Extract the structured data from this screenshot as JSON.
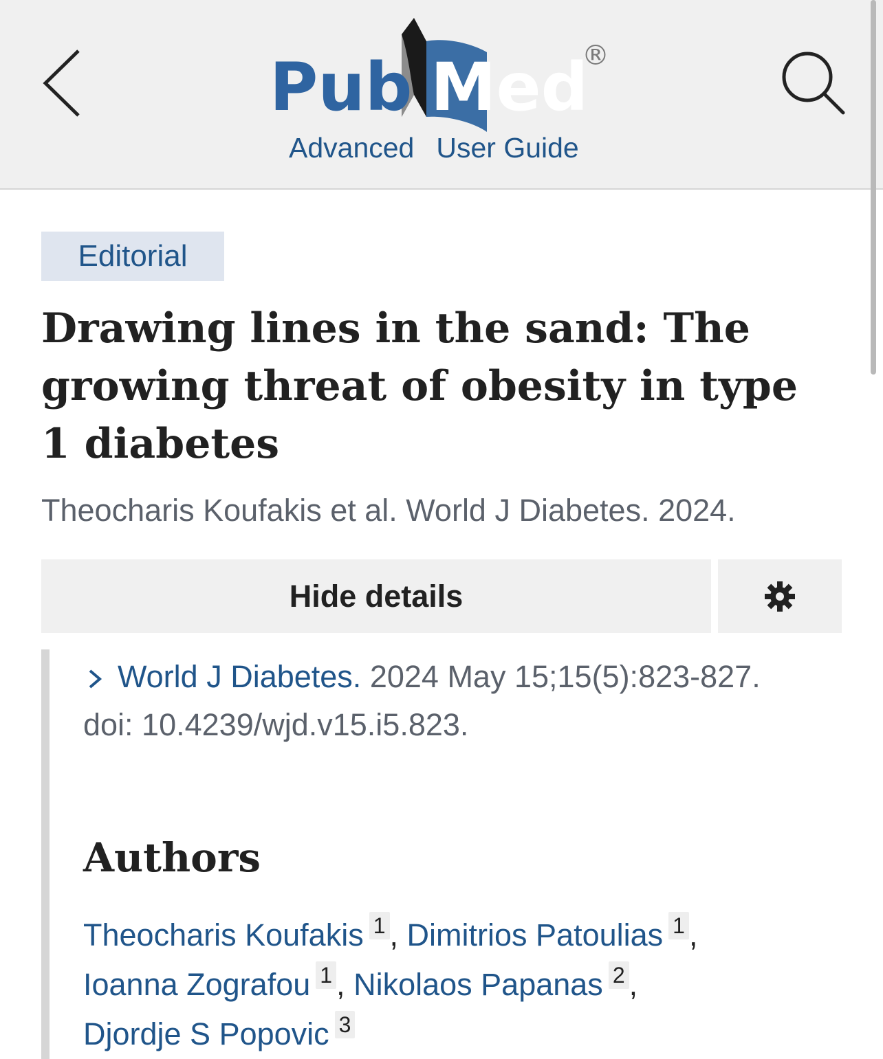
{
  "header": {
    "logo_text_left": "Pub",
    "logo_text_right": "Med",
    "logo_registered": "®",
    "links": [
      "Advanced",
      "User Guide"
    ],
    "back_icon": "chevron-left-icon",
    "search_icon": "search-icon",
    "brand_color": "#20558a"
  },
  "article": {
    "type_badge": "Editorial",
    "title": "Drawing lines in the sand: The growing threat of obesity in type 1 diabetes",
    "citation": "Theocharis Koufakis et al. World J Diabetes. 2024.",
    "hide_details_label": "Hide details",
    "settings_icon": "gear-icon",
    "journal": "World J Diabetes.",
    "journal_details": "2024 May 15;15(5):823-827.",
    "doi": "doi: 10.4239/wjd.v15.i5.823."
  },
  "authors": {
    "heading": "Authors",
    "list": [
      {
        "name": "Theocharis Koufakis",
        "aff": "1"
      },
      {
        "name": "Dimitrios Patoulias",
        "aff": "1"
      },
      {
        "name": "Ioanna Zografou",
        "aff": "1"
      },
      {
        "name": "Nikolaos Papanas",
        "aff": "2"
      },
      {
        "name": "Djordje S Popovic",
        "aff": "3"
      }
    ]
  }
}
